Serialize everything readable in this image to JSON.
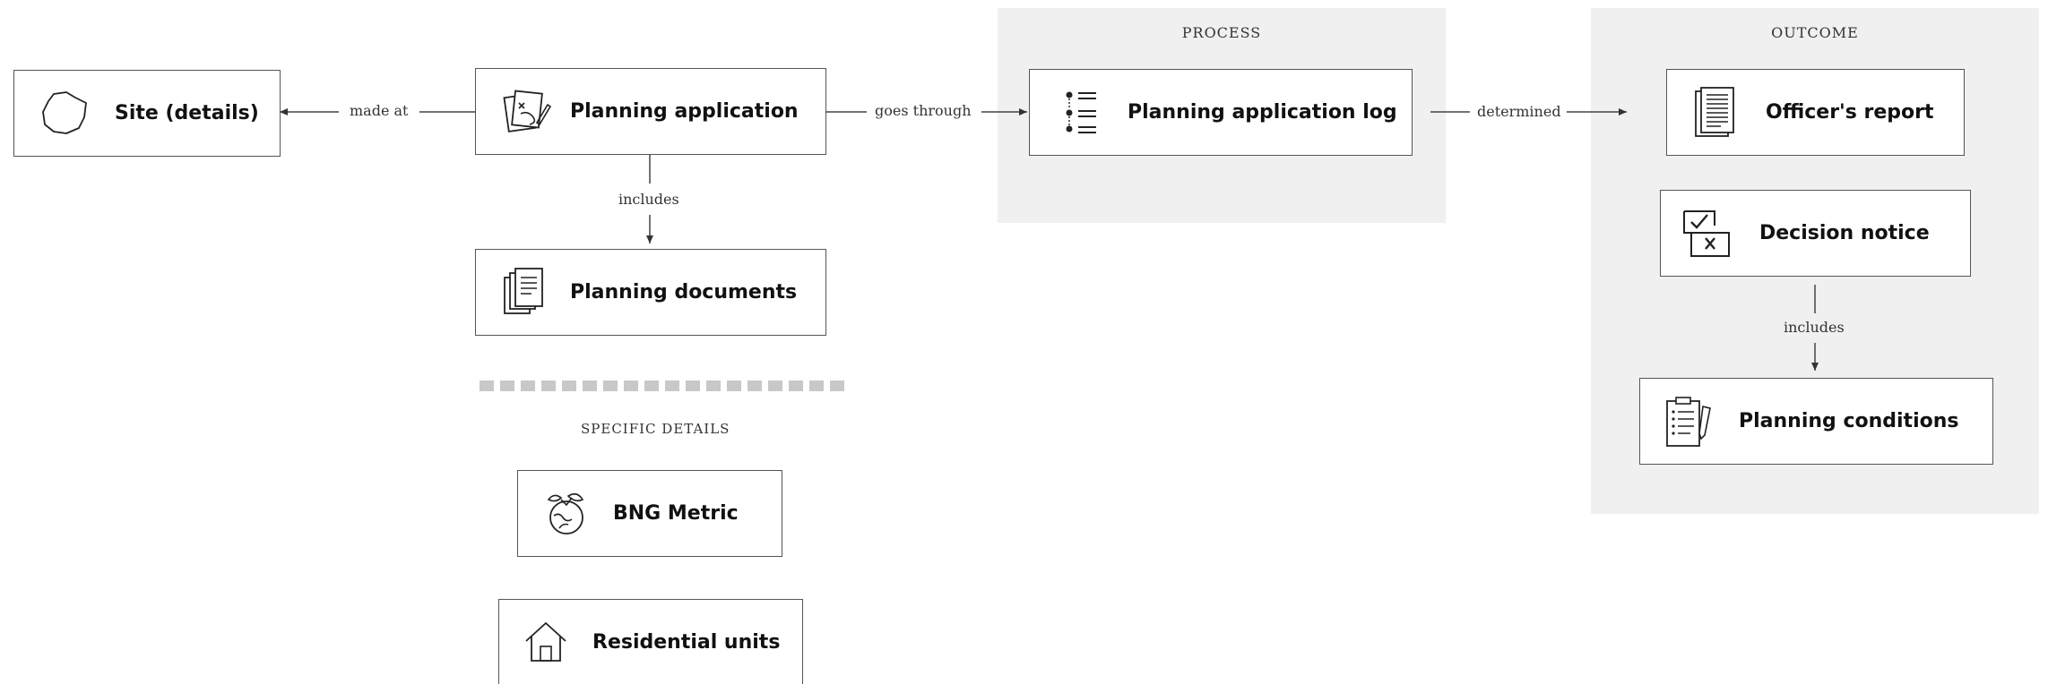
{
  "panels": {
    "process": {
      "title": "PROCESS"
    },
    "outcome": {
      "title": "OUTCOME"
    }
  },
  "nodes": {
    "site": {
      "label": "Site (details)",
      "icon": "site-boundary-icon"
    },
    "planning_application": {
      "label": "Planning application",
      "icon": "planning-application-icon"
    },
    "planning_documents": {
      "label": "Planning documents",
      "icon": "documents-stack-icon"
    },
    "planning_application_log": {
      "label": "Planning application log",
      "icon": "list-log-icon"
    },
    "officers_report": {
      "label": "Officer's report",
      "icon": "report-document-icon"
    },
    "decision_notice": {
      "label": "Decision notice",
      "icon": "decision-check-cross-icon"
    },
    "planning_conditions": {
      "label": "Planning conditions",
      "icon": "clipboard-pen-icon"
    },
    "bng_metric": {
      "label": "BNG Metric",
      "icon": "globe-biodiversity-icon"
    },
    "residential_units": {
      "label": "Residential units",
      "icon": "house-icon"
    }
  },
  "edges": {
    "made_at": "made at",
    "goes_through": "goes through",
    "includes_documents": "includes",
    "determined": "determined",
    "includes_conditions": "includes"
  },
  "sections": {
    "specific_details": "SPECIFIC DETAILS"
  }
}
